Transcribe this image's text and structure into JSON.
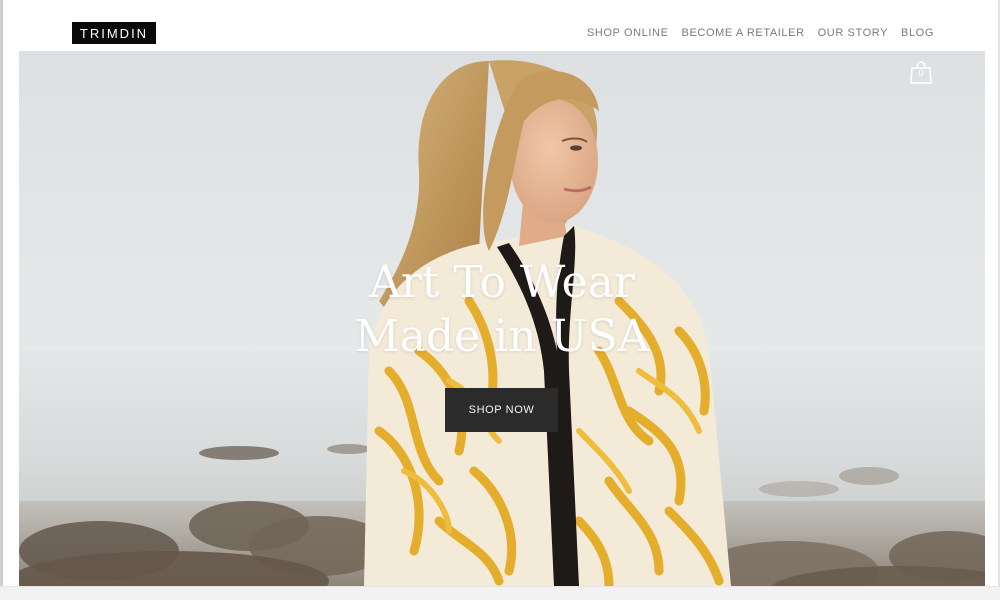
{
  "brand": {
    "logo_text": "TRIMDIN"
  },
  "nav": {
    "items": [
      {
        "label": "SHOP ONLINE"
      },
      {
        "label": "BECOME A RETAILER"
      },
      {
        "label": "OUR STORY"
      },
      {
        "label": "BLOG"
      }
    ]
  },
  "cart": {
    "count": "0",
    "icon": "shopping-bag-icon"
  },
  "hero": {
    "headline_line1": "Art  To Wear",
    "headline_line2": "Made in USA",
    "cta_label": "SHOP NOW",
    "photo": "woman-in-yellow-patterned-jacket-by-sea"
  },
  "colors": {
    "logo_bg": "#0a0a0a",
    "nav_text": "#7a7a7a",
    "cta_bg": "#2b2b2b",
    "jacket_yellow": "#e4ad2c"
  }
}
